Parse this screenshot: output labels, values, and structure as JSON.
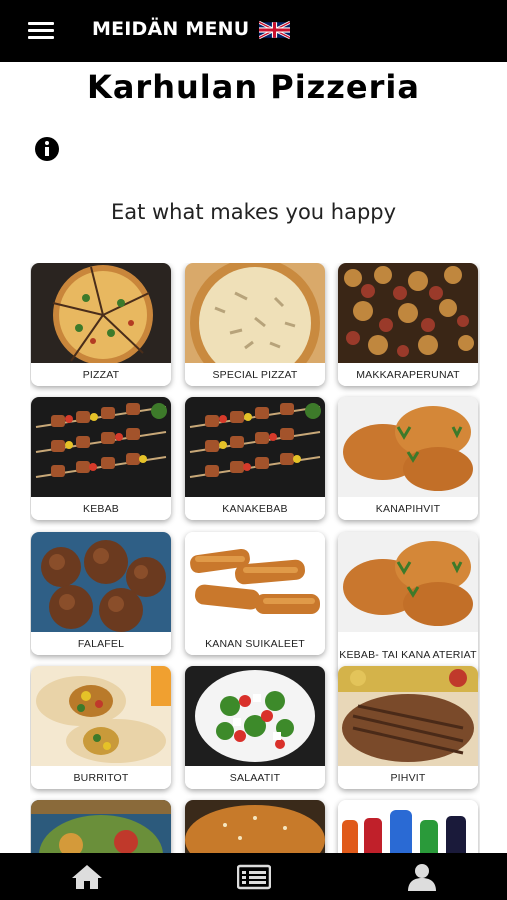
{
  "header": {
    "menu_title": "MEIDÄN MENU"
  },
  "restaurant": {
    "name": "Karhulan Pizzeria",
    "tagline": "Eat what makes you happy"
  },
  "categories": [
    {
      "label": "PIZZAT"
    },
    {
      "label": "SPECIAL PIZZAT"
    },
    {
      "label": "MAKKARAPERUNAT"
    },
    {
      "label": "KEBAB"
    },
    {
      "label": "KANAKEBAB"
    },
    {
      "label": "KANAPIHVIT"
    },
    {
      "label": "FALAFEL"
    },
    {
      "label": "KANAN SUIKALEET"
    },
    {
      "label": "KEBAB- TAI KANA ATERIAT"
    },
    {
      "label": "BURRITOT"
    },
    {
      "label": "SALAATIT"
    },
    {
      "label": "PIHVIT"
    }
  ],
  "colors": {
    "bar": "#000000",
    "background": "#ffffff",
    "icon_bottom": "#dddddd"
  },
  "icons": {
    "menu": "hamburger-icon",
    "language": "uk-flag-icon",
    "info": "info-icon",
    "home": "home-icon",
    "list": "list-icon",
    "profile": "user-icon"
  }
}
